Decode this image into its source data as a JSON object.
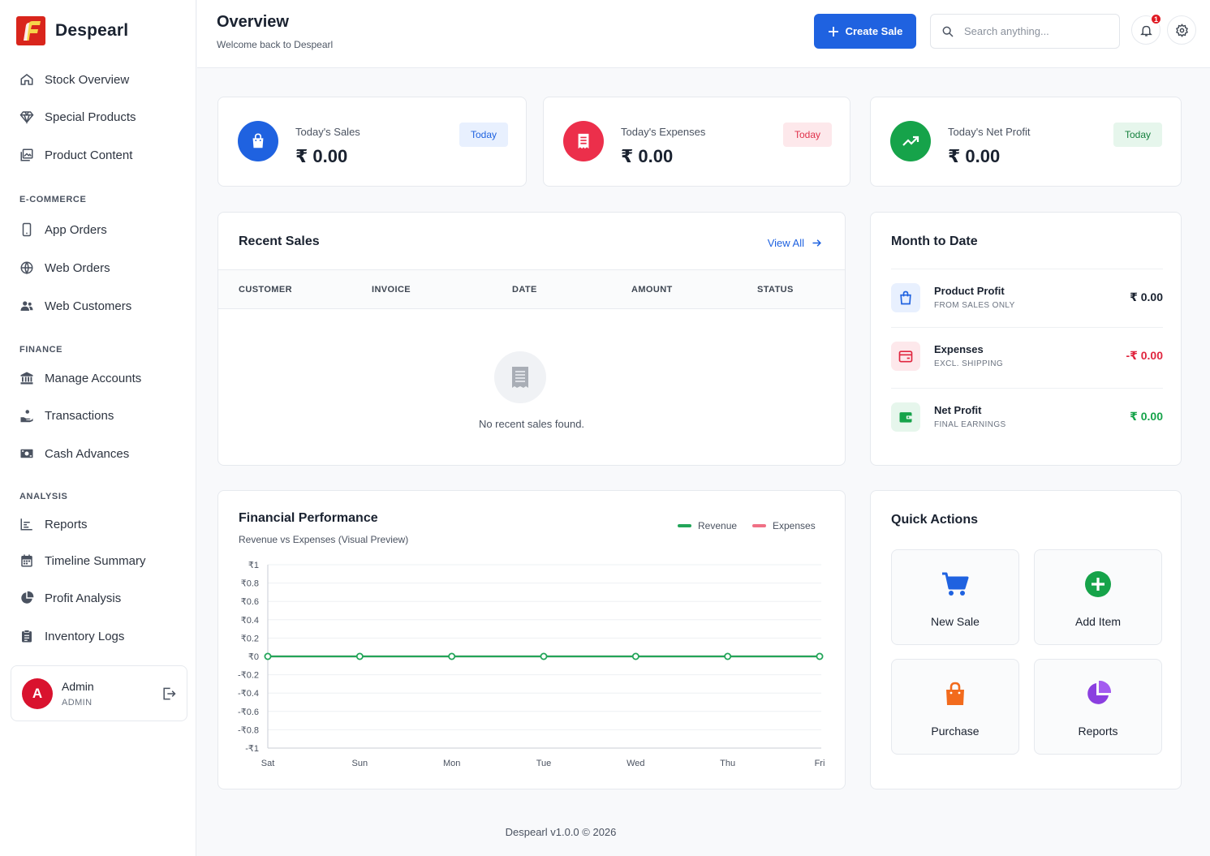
{
  "brand": {
    "name": "Despearl"
  },
  "sidebar": {
    "items_top": [
      {
        "label": "Stock Overview",
        "icon": "home-icon"
      },
      {
        "label": "Special Products",
        "icon": "gem-icon"
      },
      {
        "label": "Product Content",
        "icon": "image-icon"
      }
    ],
    "sections": [
      {
        "title": "E-COMMERCE",
        "items": [
          {
            "label": "App Orders",
            "icon": "phone-icon"
          },
          {
            "label": "Web Orders",
            "icon": "globe-icon"
          },
          {
            "label": "Web Customers",
            "icon": "users-icon"
          }
        ]
      },
      {
        "title": "FINANCE",
        "items": [
          {
            "label": "Manage Accounts",
            "icon": "bank-icon"
          },
          {
            "label": "Transactions",
            "icon": "hand-coins-icon"
          },
          {
            "label": "Cash Advances",
            "icon": "money-icon"
          }
        ]
      },
      {
        "title": "ANALYSIS",
        "items": [
          {
            "label": "Reports",
            "icon": "bar-chart-icon"
          },
          {
            "label": "Timeline Summary",
            "icon": "calendar-icon"
          },
          {
            "label": "Profit Analysis",
            "icon": "pie-chart-icon"
          },
          {
            "label": "Inventory Logs",
            "icon": "clipboard-icon"
          }
        ]
      }
    ],
    "user": {
      "initial": "A",
      "name": "Admin",
      "role": "ADMIN"
    }
  },
  "header": {
    "title": "Overview",
    "subtitle": "Welcome back to Despearl",
    "create_label": "Create Sale",
    "search_placeholder": "Search anything...",
    "notification_count": "1"
  },
  "stats": [
    {
      "label": "Today's Sales",
      "value": "₹ 0.00",
      "chip": "Today",
      "color": "#1f62e0",
      "chip_bg": "#e8f0fe",
      "chip_fg": "#1f62e0",
      "icon": "shopping-bag-icon"
    },
    {
      "label": "Today's Expenses",
      "value": "₹ 0.00",
      "chip": "Today",
      "color": "#ec2f4b",
      "chip_bg": "#fde8eb",
      "chip_fg": "#e0314b",
      "icon": "receipt-icon"
    },
    {
      "label": "Today's Net Profit",
      "value": "₹ 0.00",
      "chip": "Today",
      "color": "#16a34a",
      "chip_bg": "#e6f6ec",
      "chip_fg": "#15803d",
      "icon": "trending-up-icon"
    }
  ],
  "recent_sales": {
    "title": "Recent Sales",
    "view_all": "View All",
    "columns": [
      "CUSTOMER",
      "INVOICE",
      "DATE",
      "AMOUNT",
      "STATUS"
    ],
    "empty_text": "No recent sales found."
  },
  "month_to_date": {
    "title": "Month to Date",
    "rows": [
      {
        "name": "Product Profit",
        "sub": "FROM SALES ONLY",
        "value": "₹ 0.00",
        "color": "#1a2230",
        "icon": "shopping-bag-icon"
      },
      {
        "name": "Expenses",
        "sub": "EXCL. SHIPPING",
        "value": "-₹ 0.00",
        "color": "#e0263f",
        "icon": "card-icon"
      },
      {
        "name": "Net Profit",
        "sub": "FINAL EARNINGS",
        "value": "₹ 0.00",
        "color": "#16a34a",
        "icon": "wallet-icon"
      }
    ]
  },
  "performance": {
    "title": "Financial Performance",
    "subtitle": "Revenue vs Expenses (Visual Preview)"
  },
  "chart_data": {
    "type": "line",
    "x": [
      "Sat",
      "Sun",
      "Mon",
      "Tue",
      "Wed",
      "Thu",
      "Fri"
    ],
    "series": [
      {
        "name": "Revenue",
        "values": [
          0,
          0,
          0,
          0,
          0,
          0,
          0
        ],
        "color": "#22a559"
      },
      {
        "name": "Expenses",
        "values": [
          0,
          0,
          0,
          0,
          0,
          0,
          0
        ],
        "color": "#f07085"
      }
    ],
    "yticks": [
      "₹1",
      "₹0.8",
      "₹0.6",
      "₹0.4",
      "₹0.2",
      "₹0",
      "-₹0.2",
      "-₹0.4",
      "-₹0.6",
      "-₹0.8",
      "-₹1"
    ],
    "ylim": [
      -1,
      1
    ],
    "grid": true,
    "legend": "top-right"
  },
  "quick_actions": {
    "title": "Quick Actions",
    "items": [
      {
        "label": "New Sale",
        "icon": "cart-icon"
      },
      {
        "label": "Add Item",
        "icon": "plus-circle-icon"
      },
      {
        "label": "Purchase",
        "icon": "shopping-bag-icon"
      },
      {
        "label": "Reports",
        "icon": "pie-chart-icon"
      }
    ]
  },
  "footer": {
    "text": "Despearl v1.0.0 © 2026"
  }
}
